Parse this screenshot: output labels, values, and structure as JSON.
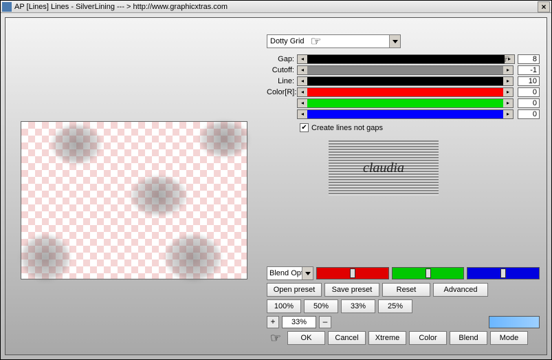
{
  "title": "AP [Lines]  Lines - SilverLining    --- >  http://www.graphicxtras.com",
  "preset_dropdown": "Dotty Grid",
  "sliders": {
    "gap": {
      "label": "Gap:",
      "value": "8",
      "color": "#000000"
    },
    "cutoff": {
      "label": "Cutoff:",
      "value": "-1",
      "color": "#888888"
    },
    "line": {
      "label": "Line:",
      "value": "10",
      "color": "#000000"
    },
    "colorR": {
      "label": "Color[R]:",
      "value": "0",
      "color": "#ff0000"
    },
    "colorG": {
      "label": "",
      "value": "0",
      "color": "#00dd00"
    },
    "colorB": {
      "label": "",
      "value": "0",
      "color": "#0000ff"
    }
  },
  "checkbox": {
    "checked": true,
    "label": "Create lines not gaps"
  },
  "logo_text": "claudia",
  "blend_mode_dropdown": "Blend Options",
  "rgb_sliders": {
    "r": "#e00000",
    "g": "#00c800",
    "b": "#0000e0"
  },
  "preset_buttons": {
    "open": "Open preset",
    "save": "Save preset",
    "reset": "Reset",
    "advanced": "Advanced"
  },
  "zoom_presets": [
    "100%",
    "50%",
    "33%",
    "25%"
  ],
  "zoom_value": "33%",
  "zoom_plus": "+",
  "zoom_minus": "–",
  "action_buttons": {
    "ok": "OK",
    "cancel": "Cancel",
    "xtreme": "Xtreme",
    "color": "Color",
    "blend": "Blend",
    "mode": "Mode"
  },
  "close": "×"
}
